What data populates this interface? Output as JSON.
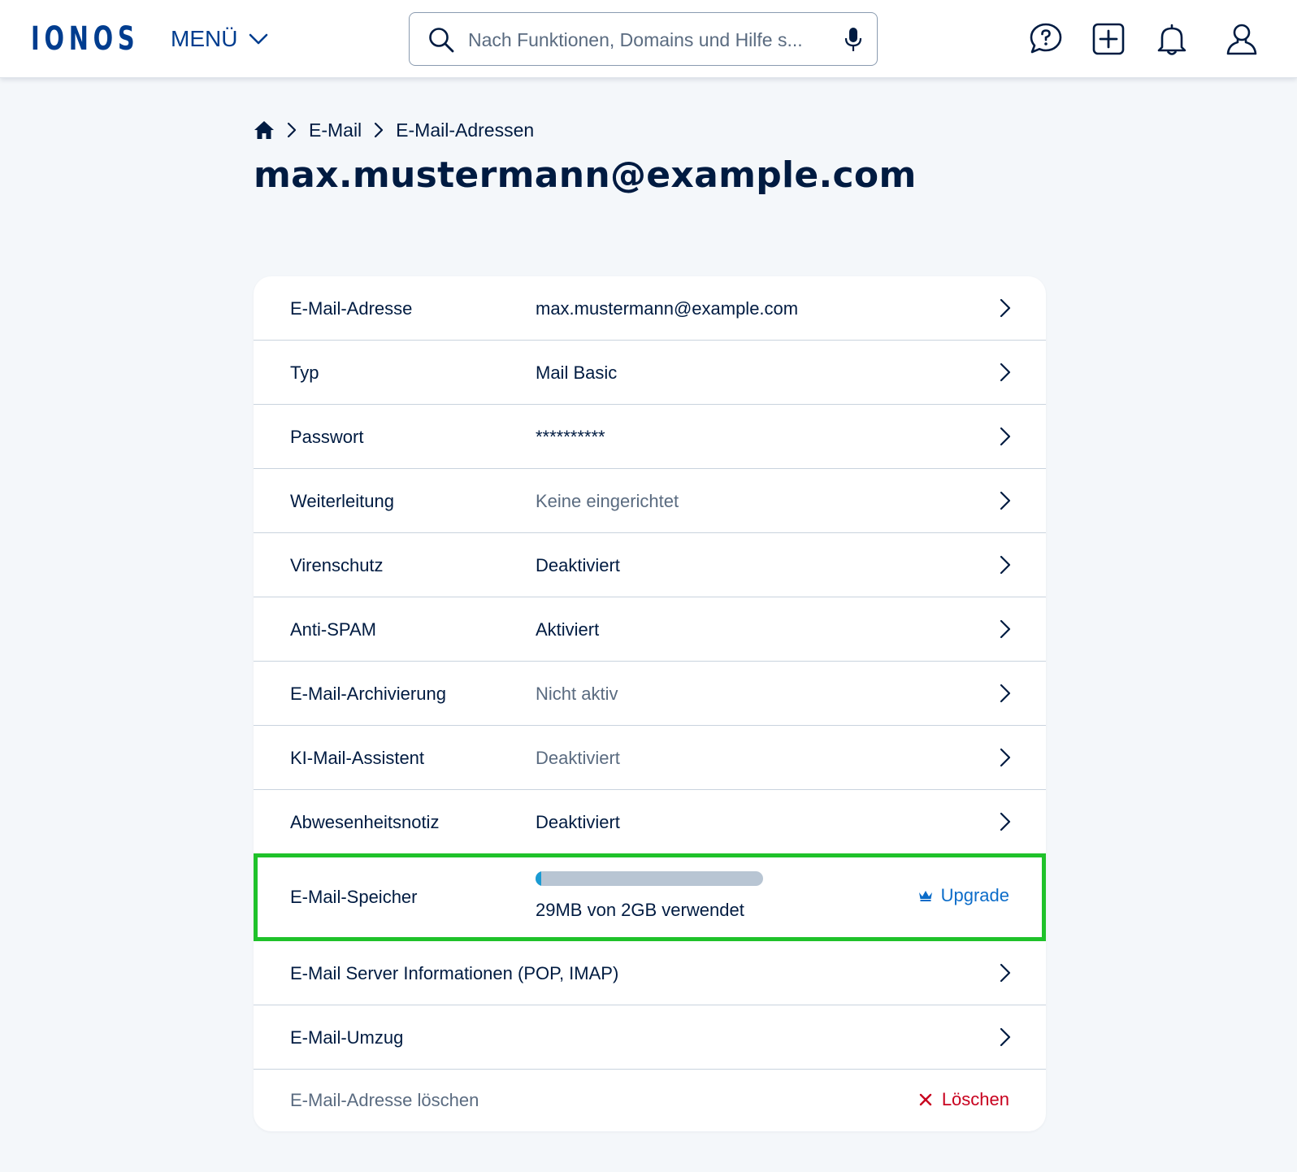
{
  "header": {
    "logo_text": "IONOS",
    "menu_label": "MENÜ",
    "search_placeholder": "Nach Funktionen, Domains und Hilfe s...",
    "icons": [
      "help-chat-icon",
      "add-icon",
      "bell-icon",
      "user-icon"
    ]
  },
  "breadcrumb": {
    "items": [
      "E-Mail",
      "E-Mail-Adressen"
    ]
  },
  "page_title": "max.mustermann@example.com",
  "rows": [
    {
      "label": "E-Mail-Adresse",
      "value": "max.mustermann@example.com",
      "muted": false
    },
    {
      "label": "Typ",
      "value": "Mail Basic",
      "muted": false
    },
    {
      "label": "Passwort",
      "value": "**********",
      "muted": false
    },
    {
      "label": "Weiterleitung",
      "value": "Keine eingerichtet",
      "muted": true
    },
    {
      "label": "Virenschutz",
      "value": "Deaktiviert",
      "muted": false
    },
    {
      "label": "Anti-SPAM",
      "value": "Aktiviert",
      "muted": false
    },
    {
      "label": "E-Mail-Archivierung",
      "value": "Nicht aktiv",
      "muted": true
    },
    {
      "label": "KI-Mail-Assistent",
      "value": "Deaktiviert",
      "muted": true
    },
    {
      "label": "Abwesenheitsnotiz",
      "value": "Deaktiviert",
      "muted": false
    }
  ],
  "storage": {
    "label": "E-Mail-Speicher",
    "usage_text": "29MB von 2GB verwendet",
    "used_fraction": 0.014,
    "upgrade_label": "Upgrade"
  },
  "extra_rows": [
    {
      "label": "E-Mail Server Informationen (POP, IMAP)"
    },
    {
      "label": "E-Mail-Umzug"
    }
  ],
  "delete": {
    "label": "E-Mail-Adresse löschen",
    "button_label": "Löschen"
  },
  "colors": {
    "brand": "#003d8f",
    "highlight_border": "#1fc22a",
    "link": "#0b6cc9",
    "danger": "#c8001e",
    "bar_fill": "#1a9bd3",
    "bar_track": "#b8c5d3"
  }
}
